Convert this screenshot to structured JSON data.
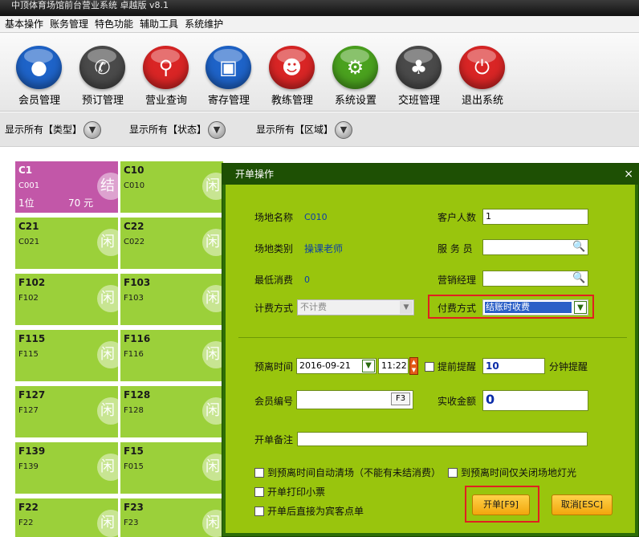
{
  "window": {
    "title": "中顶体育场馆前台营业系统 卓越版 v8.1"
  },
  "menu": [
    "基本操作",
    "账务管理",
    "特色功能",
    "辅助工具",
    "系统维护"
  ],
  "toolbar": [
    {
      "label": "会员管理",
      "icon": "person-icon",
      "color": "#1e63c8"
    },
    {
      "label": "预订管理",
      "icon": "phone-icon",
      "color": "#4a4a4a"
    },
    {
      "label": "营业查询",
      "icon": "magnifier-icon",
      "color": "#d92525"
    },
    {
      "label": "寄存管理",
      "icon": "shopping-bag-icon",
      "color": "#1e63c8"
    },
    {
      "label": "教练管理",
      "icon": "coach-icon",
      "color": "#d92525"
    },
    {
      "label": "系统设置",
      "icon": "gear-icon",
      "color": "#4aa11e"
    },
    {
      "label": "交班管理",
      "icon": "meeting-icon",
      "color": "#4a4a4a"
    },
    {
      "label": "退出系统",
      "icon": "power-icon",
      "color": "#d92525"
    }
  ],
  "filters": [
    "显示所有【类型】",
    "显示所有【状态】",
    "显示所有【区域】"
  ],
  "venues": [
    {
      "name": "C1",
      "code": "C001",
      "extra1": "1位",
      "extra2": "70 元",
      "watermark": "结",
      "active": true
    },
    {
      "name": "C10",
      "code": "C010",
      "watermark": "闲"
    },
    {
      "name": "C21",
      "code": "C021",
      "watermark": "闲"
    },
    {
      "name": "C22",
      "code": "C022",
      "watermark": "闲"
    },
    {
      "name": "F102",
      "code": "F102",
      "watermark": "闲"
    },
    {
      "name": "F103",
      "code": "F103",
      "watermark": "闲"
    },
    {
      "name": "F115",
      "code": "F115",
      "watermark": "闲"
    },
    {
      "name": "F116",
      "code": "F116",
      "watermark": "闲"
    },
    {
      "name": "F127",
      "code": "F127",
      "watermark": "闲"
    },
    {
      "name": "F128",
      "code": "F128",
      "watermark": "闲"
    },
    {
      "name": "F139",
      "code": "F139",
      "watermark": "闲"
    },
    {
      "name": "F15",
      "code": "F015",
      "watermark": "闲"
    },
    {
      "name": "F22",
      "code": "F22",
      "watermark": "闲"
    },
    {
      "name": "F23",
      "code": "F23",
      "watermark": "闲"
    }
  ],
  "dialog": {
    "title": "开单操作",
    "close": "×",
    "venue_name_label": "场地名称",
    "venue_name": "C010",
    "venue_type_label": "场地类别",
    "venue_type": "操课老师",
    "min_consume_label": "最低消费",
    "min_consume": "0",
    "billing_method_label": "计费方式",
    "billing_method": "不计费",
    "customer_count_label": "客户人数",
    "customer_count": "1",
    "waiter_label": "服 务 员",
    "waiter": "",
    "sales_manager_label": "营销经理",
    "sales_manager": "",
    "payment_method_label": "付费方式",
    "payment_method": "结账时收费",
    "leave_time_label": "预离时间",
    "leave_date": "2016-09-21",
    "leave_clock": "11:22",
    "remind_label": "提前提醒",
    "remind_minutes": "10",
    "remind_unit": "分钟提醒",
    "member_no_label": "会员编号",
    "member_no": "",
    "member_key": "F3",
    "amount_label": "实收金额",
    "amount": "0",
    "note_label": "开单备注",
    "note": "",
    "opt_auto_clear": "到预离时间自动清场（不能有未结消费）",
    "opt_lights_off": "到预离时间仅关闭场地灯光",
    "opt_print": "开单打印小票",
    "opt_guest_order": "开单后直接为宾客点单",
    "ok_label": "开单[F9]",
    "cancel_label": "取消[ESC]"
  }
}
